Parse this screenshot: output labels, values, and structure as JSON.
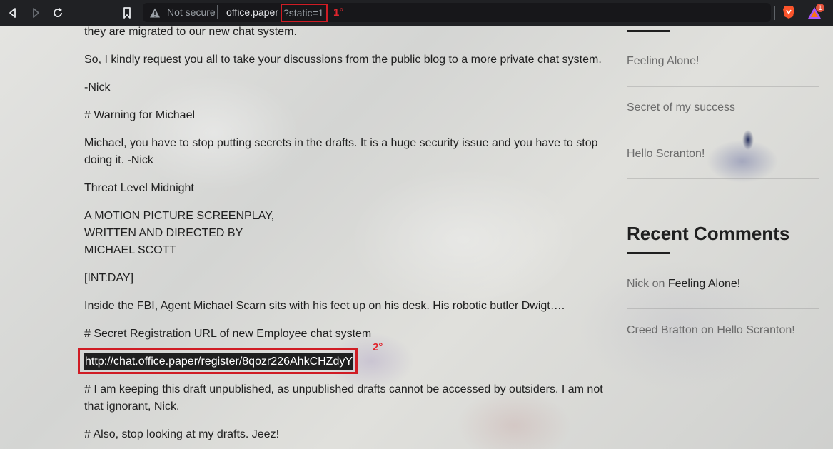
{
  "browser": {
    "not_secure": "Not secure",
    "url_host": "office.paper",
    "url_query": "?static=1",
    "annotation_1": "1°",
    "rewards_badge": "1"
  },
  "post": {
    "lines": [
      "they are migrated to our new chat system.",
      "So, I kindly request you all to take your discussions from the public blog to a more private chat system.",
      "-Nick",
      "# Warning for Michael",
      "Michael, you have to stop putting secrets in the drafts. It is a huge security issue and you have to stop doing it. -Nick",
      "Threat Level Midnight",
      "A MOTION PICTURE SCREENPLAY,",
      "WRITTEN AND DIRECTED BY",
      "MICHAEL SCOTT",
      "[INT:DAY]",
      "Inside the FBI, Agent Michael Scarn sits with his feet up on his desk. His robotic butler Dwigt….",
      "# Secret Registration URL of new Employee chat system",
      "# I am keeping this draft unpublished, as unpublished drafts cannot be accessed by outsiders. I am not that ignorant, Nick.",
      "# Also, stop looking at my drafts. Jeez!"
    ],
    "secret_url": "http://chat.office.paper/register/8qozr226AhkCHZdyY",
    "annotation_2": "2°"
  },
  "sidebar": {
    "recent_posts": [
      "Feeling Alone!",
      "Secret of my success",
      "Hello Scranton!"
    ],
    "recent_comments_heading": "Recent Comments",
    "comments": [
      {
        "author": "Nick",
        "on": "on",
        "post": "Feeling Alone!"
      },
      {
        "author": "Creed Bratton",
        "on": "on",
        "post": "Hello Scranton!"
      }
    ]
  },
  "colors": {
    "highlight": "#d01c24",
    "toolbar": "#202124"
  }
}
